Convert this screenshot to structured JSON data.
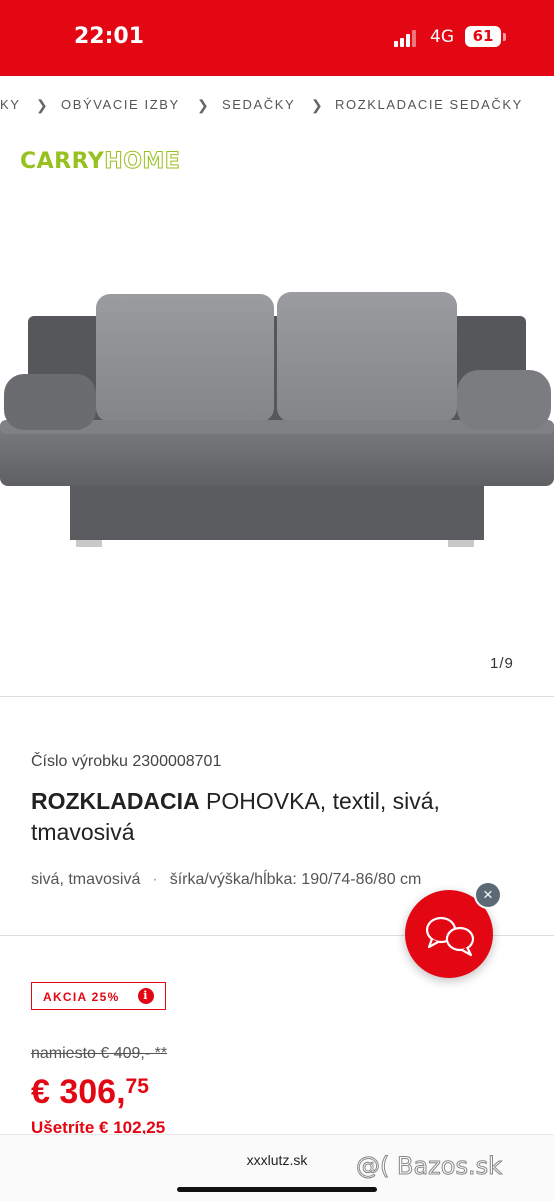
{
  "status": {
    "time": "22:01",
    "network": "4G",
    "battery": "61"
  },
  "breadcrumb": {
    "items": [
      "KY",
      "OBÝVACIE IZBY",
      "SEDAČKY",
      "ROZKLADACIE SEDAČKY"
    ]
  },
  "brand": {
    "carry": "CARRY",
    "home": "HOME"
  },
  "gallery": {
    "counter": "1/9"
  },
  "product": {
    "sku": "Číslo výrobku 2300008701",
    "title_bold": "ROZKLADACIA",
    "title_rest": " POHOVKA, textil, sivá, tmavosivá",
    "color": "sivá, tmavosivá",
    "dimensions": "šírka/výška/hĺbka: 190/74-86/80 cm"
  },
  "promo": {
    "badge": "AKCIA 25%",
    "info_icon": "i"
  },
  "pricing": {
    "old_price": "namiesto € 409,- **",
    "price_main": "€ 306,",
    "price_cents": "75",
    "savings": "Ušetríte € 102,25"
  },
  "chat": {
    "close_icon": "×"
  },
  "browser": {
    "url": "xxxlutz.sk"
  },
  "watermark": "@( Bazos.sk",
  "colors": {
    "brand_red": "#e30613",
    "carryhome_green": "#97c11f"
  }
}
